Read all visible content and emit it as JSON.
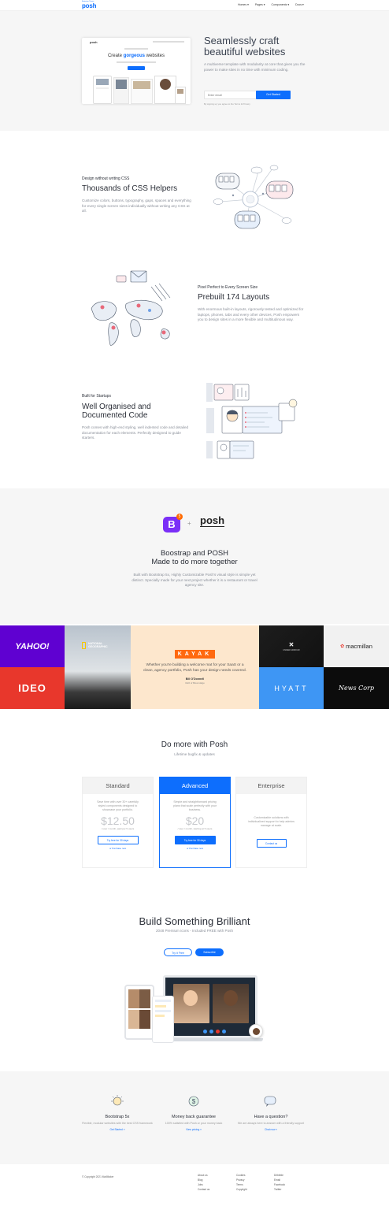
{
  "nav": {
    "logo": "posh",
    "tagline": "Bootstrap Theme",
    "links": [
      "Homes",
      "Pages",
      "Components",
      "Docs"
    ]
  },
  "hero": {
    "title": "Seamlessly craft beautiful websites",
    "subtitle": "A multiverse template with modularity at core that gives you the power to make sites in no time with minimum coding.",
    "email_placeholder": "Enter email",
    "cta": "Get Started",
    "note": "By signing up you agree to the Terms & Privacy",
    "mock_title_pre": "Create",
    "mock_title_em": "gorgeous",
    "mock_title_post": "websites"
  },
  "features": [
    {
      "kicker": "Design without writing CSS",
      "title": "Thousands of CSS Helpers",
      "text": "Customize colors, buttons, typography, gaps, spaces and everything for every single screen sizes individually without writing any CSS at all."
    },
    {
      "kicker": "Pixel Perfect to Every Screen Size",
      "title": "Prebuilt 174 Layouts",
      "text": "With enormous built-in layouts, rigorously tested and optimized for laptops, phones, tabs and every other devices, Posh empowers you to design sites in a more flexible and multitudinous way."
    },
    {
      "kicker": "Built for Startups",
      "title": "Well Organised and Documented Code",
      "text": "Posh comes with high-end styling, well indented code and detailed documentation for each elements. Perfectly designed to guide starters."
    }
  ],
  "bootstrap": {
    "badge": "5",
    "logo_text": "posh",
    "title_line1": "Boostrap and POSH",
    "title_line2": "Made to do more together",
    "text": "Built with Bootstrap 5x, Highly Customizable Posh's visual style is simple yet distinct. Specially made for your next project whether it is a restaurant or travel agency site."
  },
  "clients": {
    "yahoo": "YAHOO!",
    "ideo": "IDEO",
    "natgeo": "NATIONAL GEOGRAPHIC",
    "kayak": "KAYAK",
    "quote": "Whether you're building a welcome mat for your SaaS or a clean, agency portfolio, Posh has your design needs covered.",
    "author": "Bill O'Donnell",
    "author_role": "CEO of Bloomdalgo",
    "underarmour": "UNDER ARMOUR",
    "macmillan": "macmillan",
    "hyatt": "HYATT",
    "newscorp": "News Corp"
  },
  "pricing": {
    "title": "Do more with Posh",
    "subtitle": "Lifetime bugfix & updates",
    "plans": [
      {
        "name": "Standard",
        "desc": "Save time with over 30+ carefully styled components designed to showcase your portfolio.",
        "price": "$12.50",
        "per": "/ user / month, paid per 5 users",
        "button": "Try free for 30 days",
        "link": "or Purchase now"
      },
      {
        "name": "Advanced",
        "desc": "Simple and straightforward pricing plans that scale perfectly with your business.",
        "price": "$20",
        "per": "/ user / month, starting at 5 users",
        "button": "Try free for 30 days",
        "link": "or Purchase now"
      },
      {
        "name": "Enterprise",
        "desc": "Customizable solutions with individualized support to help admins manage at scale.",
        "button": "Contact us"
      }
    ]
  },
  "build": {
    "title": "Build Something Brilliant",
    "subtitle": "2048 Premium icons - Included FREE with Posh",
    "btn_outline": "Try it Free",
    "btn_primary": "Subscribe"
  },
  "perks": [
    {
      "title": "Bootstrap 5x",
      "desc": "Flexible, modular websites with the best CSS framework",
      "link": "Get Started »"
    },
    {
      "title": "Money back guarantee",
      "desc": "100% satisfied with Posh or your money back",
      "link": "View pricing »"
    },
    {
      "title": "Have a question?",
      "desc": "We are always here to answer with a friendly support",
      "link": "Chat now »"
    }
  ],
  "footer": {
    "copyright": "© Copyright 2021 MailMaker",
    "col1": [
      "About us",
      "Blog",
      "Jobs",
      "Contact us"
    ],
    "col2": [
      "Cookies",
      "Privacy",
      "Terms",
      "Copyright"
    ],
    "col3": [
      "Dribbble",
      "Email",
      "Facebook",
      "Twitter"
    ]
  },
  "colors": {
    "accent": "#0d6efd",
    "yahoo": "#5f01d1",
    "ideo": "#e8372c",
    "kayak": "#ff690f",
    "hyatt": "#3e96f4"
  }
}
